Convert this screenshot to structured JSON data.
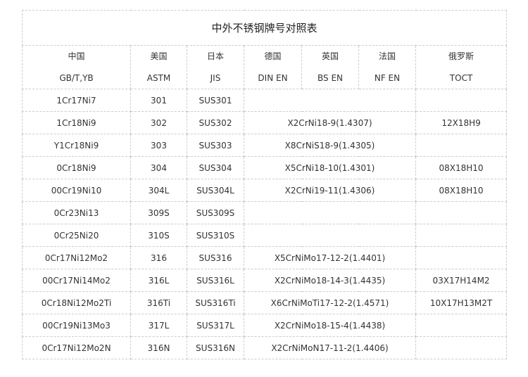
{
  "title": "中外不锈钢牌号对照表",
  "headers": [
    {
      "country": "中国",
      "standard": "GB/T,YB"
    },
    {
      "country": "美国",
      "standard": "ASTM"
    },
    {
      "country": "日本",
      "standard": "JIS"
    },
    {
      "country": "德国",
      "standard": "DIN EN"
    },
    {
      "country": "英国",
      "standard": "BS EN"
    },
    {
      "country": "法国",
      "standard": "NF EN"
    },
    {
      "country": "俄罗斯",
      "standard": "ТОСТ"
    }
  ],
  "rows": [
    {
      "cn": "1Cr17Ni7",
      "astm": "301",
      "jis": "SUS301",
      "eu": "",
      "gost": ""
    },
    {
      "cn": "1Cr18Ni9",
      "astm": "302",
      "jis": "SUS302",
      "eu": "X2CrNi18-9(1.4307)",
      "gost": "12X18H9"
    },
    {
      "cn": "Y1Cr18Ni9",
      "astm": "303",
      "jis": "SUS303",
      "eu": "X8CrNiS18-9(1.4305)",
      "gost": ""
    },
    {
      "cn": "0Cr18Ni9",
      "astm": "304",
      "jis": "SUS304",
      "eu": "X5CrNi18-10(1.4301)",
      "gost": "08X18H10"
    },
    {
      "cn": "00Cr19Ni10",
      "astm": "304L",
      "jis": "SUS304L",
      "eu": "X2CrNi19-11(1.4306)",
      "gost": "08X18H10"
    },
    {
      "cn": "0Cr23Ni13",
      "astm": "309S",
      "jis": "SUS309S",
      "eu": "",
      "gost": ""
    },
    {
      "cn": "0Cr25Ni20",
      "astm": "310S",
      "jis": "SUS310S",
      "eu": "",
      "gost": ""
    },
    {
      "cn": "0Cr17Ni12Mo2",
      "astm": "316",
      "jis": "SUS316",
      "eu": "X5CrNiMo17-12-2(1.4401)",
      "gost": ""
    },
    {
      "cn": "00Cr17Ni14Mo2",
      "astm": "316L",
      "jis": "SUS316L",
      "eu": "X2CrNiMo18-14-3(1.4435)",
      "gost": "03X17H14M2"
    },
    {
      "cn": "0Cr18Ni12Mo2Ti",
      "astm": "316Ti",
      "jis": "SUS316Ti",
      "eu": "X6CrNiMoTi17-12-2(1.4571)",
      "gost": "10X17H13M2T"
    },
    {
      "cn": "00Cr19Ni13Mo3",
      "astm": "317L",
      "jis": "SUS317L",
      "eu": "X2CrNiMo18-15-4(1.4438)",
      "gost": ""
    },
    {
      "cn": "0Cr17Ni12Mo2N",
      "astm": "316N",
      "jis": "SUS316N",
      "eu": "X2CrNiMoN17-11-2(1.4406)",
      "gost": ""
    }
  ]
}
